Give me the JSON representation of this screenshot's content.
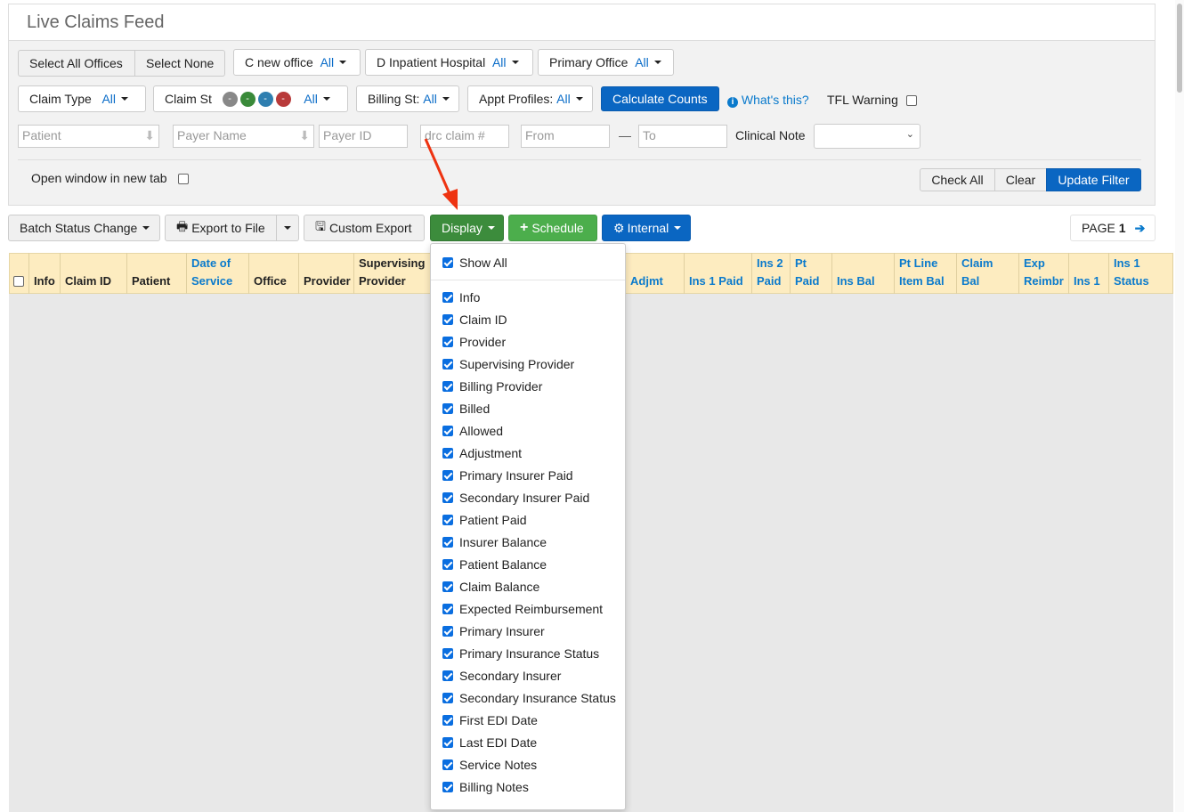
{
  "title": "Live Claims Feed",
  "offices": {
    "select_all": "Select All Offices",
    "select_none": "Select None",
    "filters": [
      {
        "label": "C new office",
        "value": "All"
      },
      {
        "label": "D Inpatient Hospital",
        "value": "All"
      },
      {
        "label": "Primary Office",
        "value": "All"
      }
    ]
  },
  "row2": {
    "claim_type": {
      "label": "Claim Type",
      "value": "All"
    },
    "claim_st": {
      "label": "Claim St",
      "value": "All",
      "dots": [
        {
          "text": "-",
          "color": "#888888"
        },
        {
          "text": "-",
          "color": "#3a8a3a"
        },
        {
          "text": "-",
          "color": "#2f7fb0"
        },
        {
          "text": "-",
          "color": "#b83a3a"
        }
      ]
    },
    "billing_st": {
      "label": "Billing St:",
      "value": "All"
    },
    "appt_profiles": {
      "label": "Appt Profiles:",
      "value": "All"
    },
    "calculate": "Calculate Counts",
    "whats_this": "What's this?",
    "tfl_warning": "TFL Warning"
  },
  "row3": {
    "patient_ph": "Patient",
    "payer_name_ph": "Payer Name",
    "payer_id_ph": "Payer ID",
    "drc_claim_ph": "drc claim #",
    "from_ph": "From",
    "dash": "—",
    "to_ph": "To",
    "clinical_note": "Clinical Note"
  },
  "open_new_tab": "Open window in new tab",
  "filter_actions": {
    "check_all": "Check All",
    "clear": "Clear",
    "update": "Update Filter"
  },
  "toolbar": {
    "batch": "Batch Status Change",
    "export": "Export to File",
    "custom_export": "Custom Export",
    "display": "Display",
    "schedule": "Schedule",
    "internal": "Internal",
    "page_label": "PAGE",
    "page_num": "1"
  },
  "colors": {
    "primary": "#0a66c2",
    "success_dark": "#3c8c3c",
    "success": "#4cae4c",
    "header_bg": "#fdecc0",
    "arrow": "#ee3311"
  },
  "columns": [
    "Info",
    "Claim ID",
    "Patient",
    "Date of Service",
    "Office",
    "Provider",
    "Supervising Provider",
    "Adjmt",
    "Ins 1 Paid",
    "Ins 2 Paid",
    "Pt Paid",
    "Ins Bal",
    "Pt Line Item Bal",
    "Claim Bal",
    "Exp Reimbr",
    "Ins 1",
    "Ins 1 Status"
  ],
  "display_menu": {
    "show_all": "Show All",
    "items": [
      "Info",
      "Claim ID",
      "Provider",
      "Supervising Provider",
      "Billing Provider",
      "Billed",
      "Allowed",
      "Adjustment",
      "Primary Insurer Paid",
      "Secondary Insurer Paid",
      "Patient Paid",
      "Insurer Balance",
      "Patient Balance",
      "Claim Balance",
      "Expected Reimbursement",
      "Primary Insurer",
      "Primary Insurance Status",
      "Secondary Insurer",
      "Secondary Insurance Status",
      "First EDI Date",
      "Last EDI Date",
      "Service Notes",
      "Billing Notes"
    ]
  }
}
